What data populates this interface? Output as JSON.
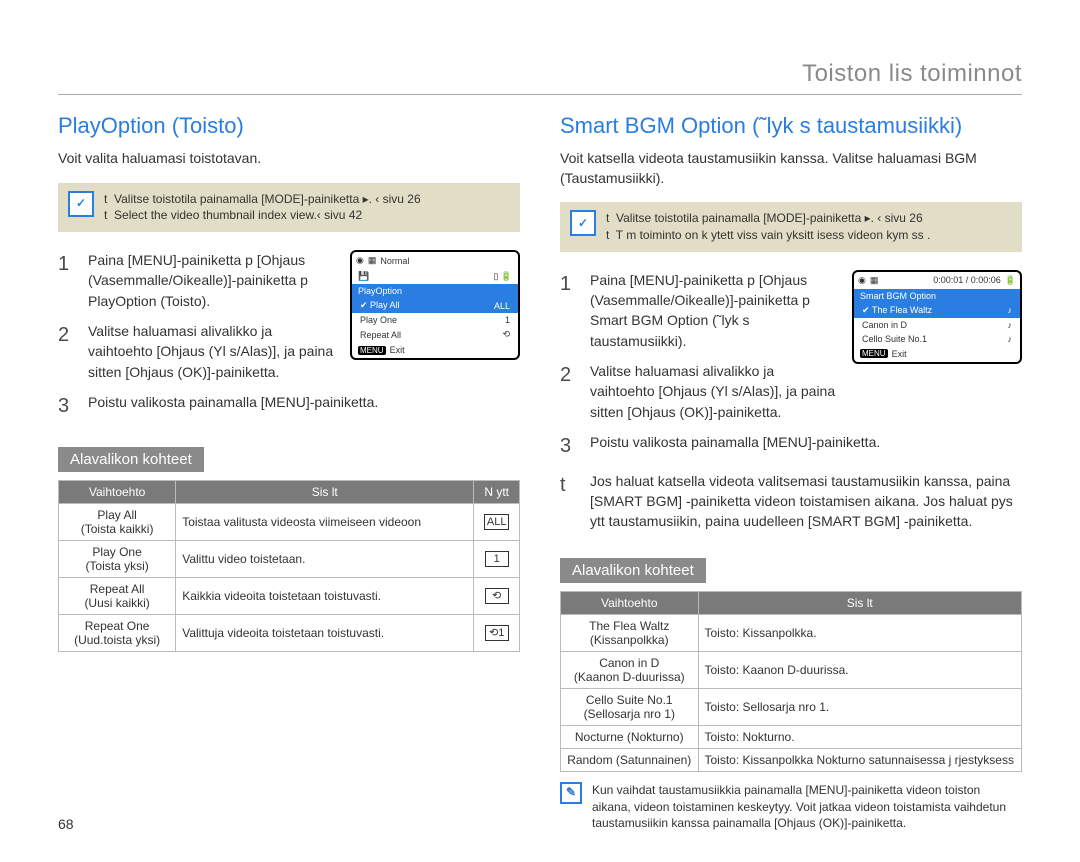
{
  "section_title": "Toiston lis toiminnot",
  "page_number": "68",
  "left": {
    "heading": "PlayOption (Toisto)",
    "intro": "Voit valita haluamasi toistotavan.",
    "note": {
      "lines": [
        "Valitse toistotila painamalla [MODE]-painiketta ▸. ‹ sivu 26",
        "Select the video thumbnail index view.‹ sivu 42"
      ]
    },
    "steps": [
      "Paina [MENU]-painiketta p [Ohjaus (Vasemmalle/Oikealle)]-painiketta p PlayOption (Toisto).",
      "Valitse haluamasi alivalikko ja vaihtoehto [Ohjaus (Yl s/Alas)], ja paina sitten [Ohjaus (OK)]-painiketta.",
      "Poistu valikosta painamalla [MENU]-painiketta."
    ],
    "lcd": {
      "mode": "Normal",
      "title": "PlayOption",
      "items": [
        "Play All",
        "Play One",
        "Repeat All"
      ],
      "exit": "Exit",
      "menu": "MENU"
    },
    "subheading": "Alavalikon kohteet",
    "table": {
      "headers": [
        "Vaihtoehto",
        "Sis lt",
        "N ytt"
      ],
      "rows": [
        {
          "opt": "Play All",
          "opt2": "(Toista kaikki)",
          "desc": "Toistaa valitusta videosta viimeiseen videoon",
          "icon": "ALL"
        },
        {
          "opt": "Play One",
          "opt2": "(Toista yksi)",
          "desc": "Valittu video toistetaan.",
          "icon": "1"
        },
        {
          "opt": "Repeat All",
          "opt2": "(Uusi kaikki)",
          "desc": "Kaikkia videoita toistetaan toistuvasti.",
          "icon": "⟲"
        },
        {
          "opt": "Repeat One",
          "opt2": "(Uud.toista yksi)",
          "desc": "Valittuja videoita toistetaan toistuvasti.",
          "icon": "⟲1"
        }
      ]
    }
  },
  "right": {
    "heading": "Smart BGM Option (˜lyk s taustamusiikki)",
    "intro": "Voit katsella videota taustamusiikin kanssa. Valitse haluamasi BGM (Taustamusiikki).",
    "note": {
      "lines": [
        "Valitse toistotila painamalla [MODE]-painiketta ▸. ‹ sivu 26",
        "T m  toiminto on k ytett viss  vain yksitt isess  videon kym ss ."
      ]
    },
    "steps": [
      "Paina [MENU]-painiketta p [Ohjaus (Vasemmalle/Oikealle)]-painiketta p Smart BGM Option (˜lyk s taustamusiikki).",
      "Valitse haluamasi alivalikko ja vaihtoehto [Ohjaus (Yl s/Alas)], ja paina sitten [Ohjaus (OK)]-painiketta.",
      "Poistu valikosta painamalla [MENU]-painiketta.",
      "Jos haluat katsella videota valitsemasi taustamusiikin kanssa, paina [SMART BGM] -painiketta videon toistamisen aikana. Jos haluat pys ytt  taustamusiikin, paina uudelleen [SMART BGM] -painiketta."
    ],
    "lcd": {
      "time": "0:00:01 / 0:00:06",
      "title": "Smart BGM Option",
      "items": [
        "The Flea Waltz",
        "Canon in D",
        "Cello Suite No.1"
      ],
      "exit": "Exit",
      "menu": "MENU"
    },
    "subheading": "Alavalikon kohteet",
    "table": {
      "headers": [
        "Vaihtoehto",
        "Sis lt"
      ],
      "rows": [
        {
          "opt": "The Flea Waltz",
          "opt2": "(Kissanpolkka)",
          "desc": "Toisto: Kissanpolkka."
        },
        {
          "opt": "Canon in D",
          "opt2": "(Kaanon D-duurissa)",
          "desc": "Toisto: Kaanon D-duurissa."
        },
        {
          "opt": "Cello Suite No.1",
          "opt2": "(Sellosarja nro 1)",
          "desc": "Toisto: Sellosarja nro 1."
        },
        {
          "opt": "Nocturne (Nokturno)",
          "opt2": "",
          "desc": "Toisto: Nokturno."
        },
        {
          "opt": "Random (Satunnainen)",
          "opt2": "",
          "desc": "Toisto: Kissanpolkka Nokturno satunnaisessa j rjestyksess"
        }
      ]
    },
    "footnote": "Kun vaihdat taustamusiikkia painamalla [MENU]-painiketta videon toiston aikana, videon toistaminen keskeytyy. Voit jatkaa videon toistamista vaihdetun taustamusiikin kanssa painamalla [Ohjaus (OK)]-painiketta."
  }
}
